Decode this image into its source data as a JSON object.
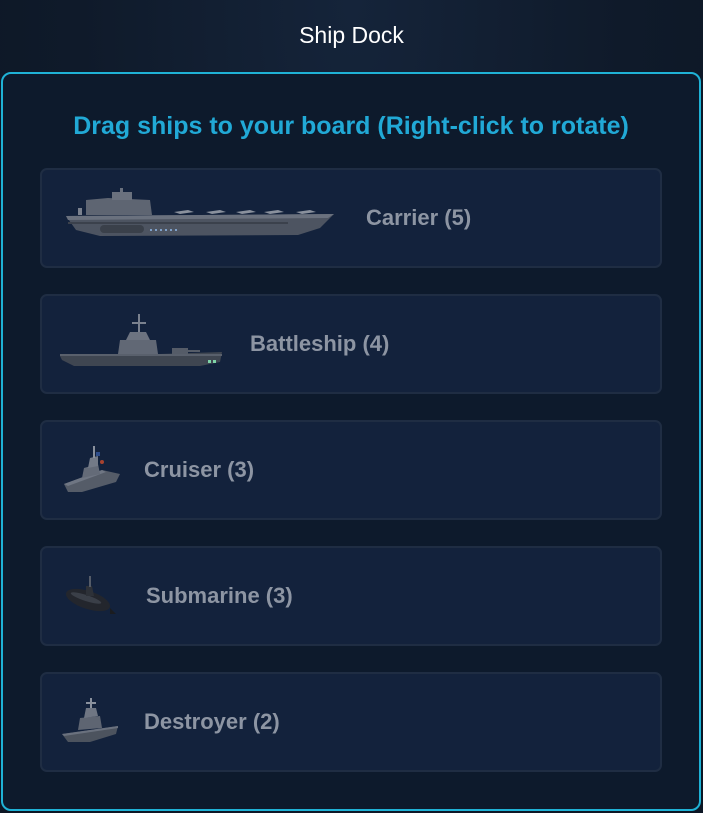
{
  "window": {
    "title": "Ship Dock"
  },
  "dock": {
    "instructions": "Drag ships to your board (Right-click to rotate)",
    "ships": [
      {
        "label": "Carrier (5)",
        "icon": "carrier-icon"
      },
      {
        "label": "Battleship (4)",
        "icon": "battleship-icon"
      },
      {
        "label": "Cruiser (3)",
        "icon": "cruiser-icon"
      },
      {
        "label": "Submarine (3)",
        "icon": "submarine-icon"
      },
      {
        "label": "Destroyer (2)",
        "icon": "destroyer-icon"
      }
    ]
  },
  "colors": {
    "accent": "#1fb2d6",
    "title_text": "#ffffff",
    "card_bg": "#13223c",
    "label_text": "#8d95a3"
  }
}
